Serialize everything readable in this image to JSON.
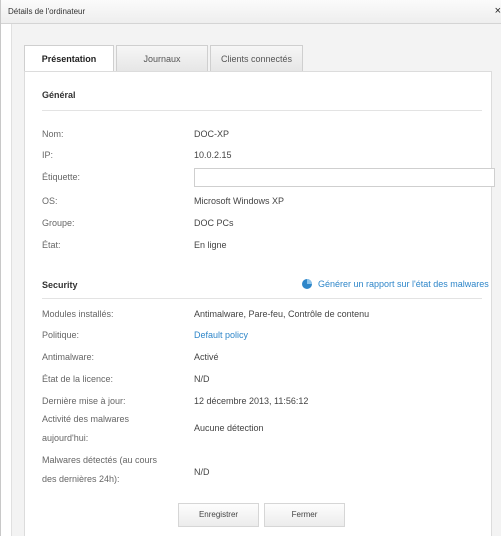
{
  "window": {
    "title": "Détails de l'ordinateur",
    "close_label": "×"
  },
  "tabs": [
    {
      "label": "Présentation"
    },
    {
      "label": "Journaux"
    },
    {
      "label": "Clients connectés"
    }
  ],
  "general": {
    "title": "Général",
    "name_label": "Nom:",
    "name_value": "DOC-XP",
    "ip_label": "IP:",
    "ip_value": "10.0.2.15",
    "tag_label": "Étiquette:",
    "tag_value": "",
    "os_label": "OS:",
    "os_value": "Microsoft Windows XP",
    "group_label": "Groupe:",
    "group_value": "DOC PCs",
    "state_label": "État:",
    "state_value": "En ligne"
  },
  "security": {
    "title": "Security",
    "report_link": "Générer un rapport sur l'état des malwares",
    "modules_label": "Modules installés:",
    "modules_value": "Antimalware, Pare-feu, Contrôle de contenu",
    "policy_label": "Politique:",
    "policy_value": "Default policy",
    "antimalware_label": "Antimalware:",
    "antimalware_value": "Activé",
    "license_label": "État de la licence:",
    "license_value": "N/D",
    "update_label": "Dernière mise à jour:",
    "update_value": "12 décembre 2013, 11:56:12",
    "activity_label_1": "Activité des malwares",
    "activity_label_2": "aujourd'hui:",
    "activity_value": "Aucune détection",
    "detected_label_1": "Malwares détectés (au cours",
    "detected_label_2": "des dernières 24h):",
    "detected_value": "N/D"
  },
  "buttons": {
    "save": "Enregistrer",
    "close": "Fermer"
  },
  "colors": {
    "link": "#2e86c9",
    "panel_bg": "#f3f3f3"
  }
}
